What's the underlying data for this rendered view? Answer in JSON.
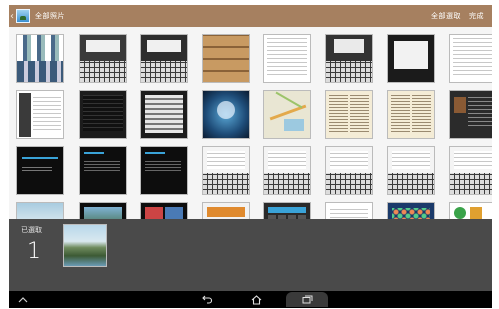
{
  "topbar": {
    "title": "全部照片",
    "select_all": "全部選取",
    "done": "完成"
  },
  "icons": {
    "back": "chevron-left-icon",
    "app": "gallery-app-icon",
    "home": "home-icon",
    "nav_back": "back-arrow-icon",
    "recent": "recent-apps-icon",
    "keyboard_hide": "hide-keyboard-icon"
  },
  "selection": {
    "label": "已選取",
    "count": "1"
  },
  "colors": {
    "topbar": "#a68060",
    "selection_bar": "#4a4a4a",
    "navbar": "#000000"
  }
}
